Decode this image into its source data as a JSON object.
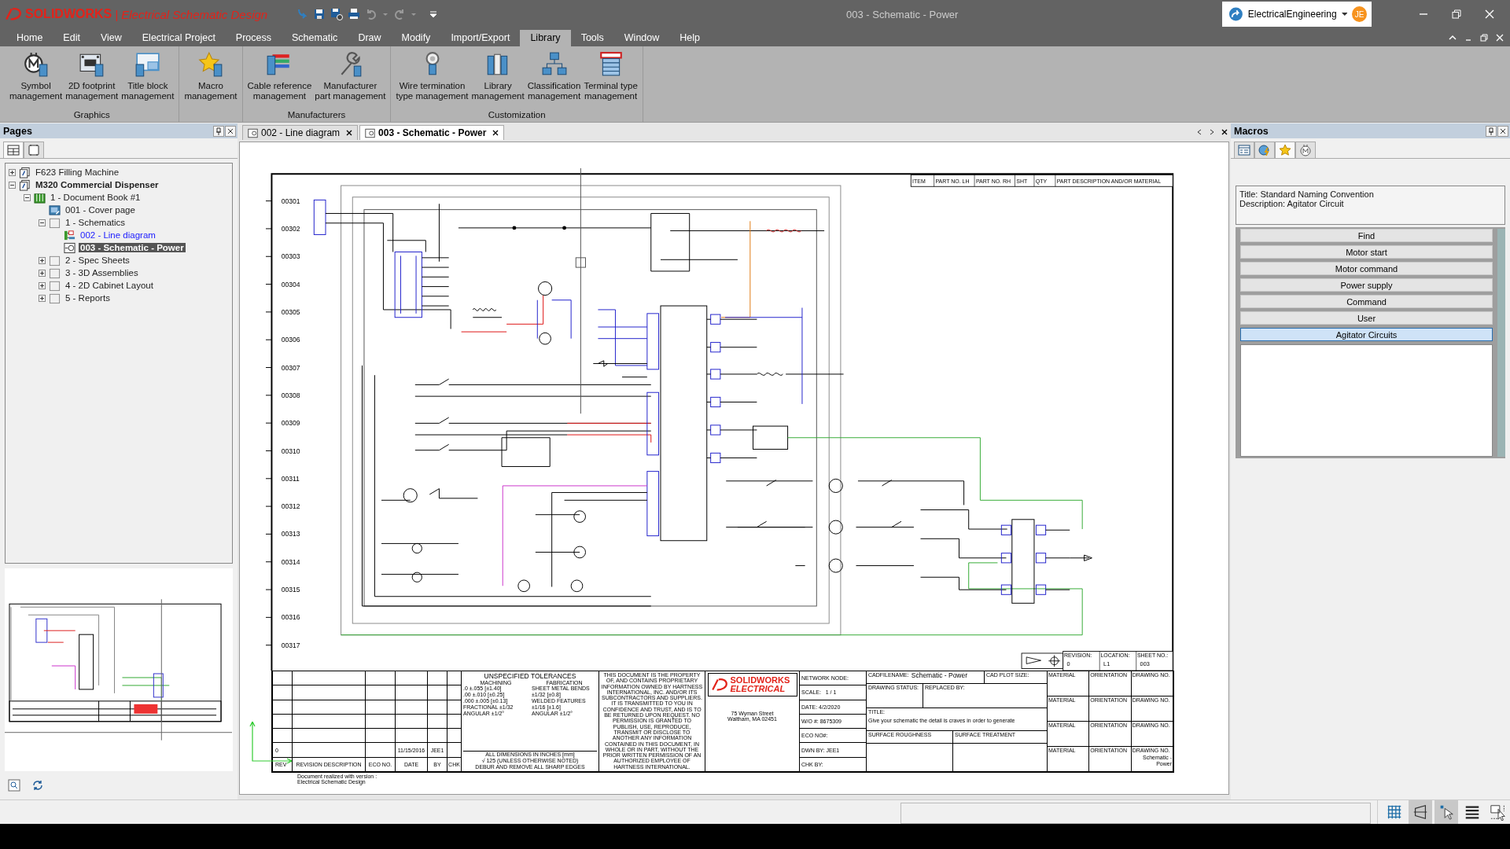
{
  "window": {
    "app_brand": "SOLIDWORKS",
    "app_name": "| Electrical Schematic Design",
    "title": "003 - Schematic - Power",
    "account": "ElectricalEngineering",
    "avatar_initials": "JE"
  },
  "menu_tabs": [
    {
      "label": "Home",
      "selected": false
    },
    {
      "label": "Edit",
      "selected": false
    },
    {
      "label": "View",
      "selected": false
    },
    {
      "label": "Electrical Project",
      "selected": false
    },
    {
      "label": "Process",
      "selected": false
    },
    {
      "label": "Schematic",
      "selected": false
    },
    {
      "label": "Draw",
      "selected": false
    },
    {
      "label": "Modify",
      "selected": false
    },
    {
      "label": "Import/Export",
      "selected": false
    },
    {
      "label": "Library",
      "selected": true
    },
    {
      "label": "Tools",
      "selected": false
    },
    {
      "label": "Window",
      "selected": false
    },
    {
      "label": "Help",
      "selected": false
    }
  ],
  "ribbon_groups": [
    {
      "label": "Graphics",
      "buttons": [
        "Symbol\nmanagement",
        "2D footprint\nmanagement",
        "Title block\nmanagement"
      ]
    },
    {
      "buttons": [
        "Macro\nmanagement"
      ]
    },
    {
      "label": "Manufacturers",
      "buttons": [
        "Cable reference\nmanagement",
        "Manufacturer\npart management"
      ]
    },
    {
      "label": "Customization",
      "buttons": [
        "Wire termination\ntype management",
        "Library\nmanagement",
        "Classification\nmanagement",
        "Terminal type\nmanagement"
      ]
    }
  ],
  "pages_panel": {
    "title": "Pages",
    "tabs": [
      {
        "selected": true
      },
      {
        "selected": false
      }
    ],
    "tree": [
      {
        "label": "F623 Filling Machine",
        "kind": "project",
        "active": false,
        "expanded": false,
        "selected": false
      },
      {
        "label": "M320 Commercial Dispenser",
        "kind": "project",
        "active": true,
        "expanded": true,
        "selected": false,
        "children": [
          {
            "label": "1 - Document Book #1",
            "kind": "book",
            "expanded": true,
            "selected": false,
            "children": [
              {
                "label": "001 - Cover page",
                "kind": "cover",
                "selected": false,
                "open": false
              },
              {
                "label": "1 - Schematics",
                "kind": "folder",
                "expanded": true,
                "selected": false,
                "children": [
                  {
                    "label": "002 - Line diagram",
                    "kind": "line-diagram",
                    "selected": false,
                    "open": true
                  },
                  {
                    "label": "003 - Schematic - Power",
                    "kind": "schematic",
                    "selected": true,
                    "open": true
                  }
                ]
              },
              {
                "label": "2 - Spec Sheets",
                "kind": "folder",
                "expanded": false,
                "selected": false
              },
              {
                "label": "3 - 3D Assemblies",
                "kind": "folder",
                "expanded": false,
                "selected": false
              },
              {
                "label": "4 - 2D Cabinet Layout",
                "kind": "folder",
                "expanded": false,
                "selected": false
              },
              {
                "label": "5 - Reports",
                "kind": "folder",
                "expanded": false,
                "selected": false
              }
            ]
          }
        ]
      }
    ]
  },
  "doc_tabs": [
    {
      "label": "002 - Line diagram",
      "selected": false
    },
    {
      "label": "003 - Schematic - Power",
      "selected": true
    }
  ],
  "schematic": {
    "row_numbers": [
      "00301",
      "00302",
      "00303",
      "00304",
      "00305",
      "00306",
      "00307",
      "00308",
      "00309",
      "00310",
      "00311",
      "00312",
      "00313",
      "00314",
      "00315",
      "00316",
      "00317"
    ],
    "parts_list_header": [
      "ITEM",
      "PART NO. LH",
      "PART NO. RH",
      "SHT",
      "QTY",
      "PART DESCRIPTION AND/OR MATERIAL"
    ],
    "sheet_info": {
      "labels": [
        "REVISION:",
        "LOCATION:",
        "SHEET NO.:"
      ],
      "values": [
        "0",
        "L1",
        "003"
      ]
    },
    "revision_headers": [
      "REV",
      "REVISION DESCRIPTION",
      "ECO NO.",
      "DATE",
      "BY",
      "CHK"
    ],
    "revision": {
      "rev": "0",
      "date": "11/15/2016",
      "by": "JEE1"
    },
    "tolerances": {
      "title": "UNSPECIFIED TOLERANCES",
      "machining_label": "MACHINING",
      "fabrication_label": "FABRICATION",
      "machining": [
        ".0   ±.055 [±1.40]",
        ".00   ±.010 [±0.25]",
        ".000  ±.005 [±0.13]",
        "FRACTIONAL ±1/32",
        "ANGULAR  ±1/2°"
      ],
      "fabrication": [
        "SHEET METAL BENDS  ±1/32 [±0.8]",
        "WELDED FEATURES  ±1/16 [±1.6]",
        "ANGULAR  ±1/2°"
      ],
      "notes": [
        "ALL DIMENSIONS IN INCHES [mm]",
        "√ 125 (UNLESS OTHERWISE NOTED)",
        "DEBUR AND REMOVE ALL SHARP EDGES"
      ]
    },
    "property_notice": "THIS DOCUMENT IS THE PROPERTY OF, AND CONTAINS PROPRIETARY INFORMATION OWNED BY HARTNESS INTERNATIONAL, INC. AND/OR ITS SUBCONTRACTORS AND SUPPLIERS. IT IS TRANSMITTED TO YOU IN CONFIDENCE AND TRUST, AND IS TO BE RETURNED UPON REQUEST. NO PERMISSION IS GRANTED TO PUBLISH, USE, REPRODUCE, TRANSMIT OR DISCLOSE TO ANOTHER ANY INFORMATION CONTAINED IN THIS DOCUMENT, IN WHOLE OR IN PART, WITHOUT THE PRIOR WRITTEN PERMISSION OF AN AUTHORIZED EMPLOYEE OF HARTNESS INTERNATIONAL.",
    "company": {
      "logo_top": "SOLIDWORKS",
      "logo_bottom": "ELECTRICAL",
      "address": [
        "75 Wyman Street",
        "Waltham, MA 02451"
      ]
    },
    "drawing_info": [
      "NETWORK NODE:",
      "SCALE:   1 / 1",
      "DATE: 4/2/2020",
      "W/O #: 8675309",
      "ECO NO#:",
      "DWN BY: JEE1",
      "CHK BY:"
    ],
    "cad": {
      "filename_label": "CADFILENAME:",
      "filename": "Schematic - Power",
      "plot_size_label": "CAD PLOT SIZE:",
      "status_label": "DRAWING STATUS:",
      "replaced_label": "REPLACED BY:",
      "title_label": "TITLE:",
      "title": "Give your schematic the detail is craves in order to generate",
      "roughness_label": "SURFACE ROUGHNESS",
      "treatment_label": "SURFACE TREATMENT"
    },
    "material_rows": [
      {
        "labels": [
          "MATERIAL",
          "ORIENTATION",
          "DRAWING NO."
        ]
      },
      {
        "labels": [
          "MATERIAL",
          "ORIENTATION",
          "DRAWING NO."
        ]
      },
      {
        "labels": [
          "MATERIAL",
          "ORIENTATION",
          "DRAWING NO."
        ]
      },
      {
        "labels": [
          "MATERIAL",
          "ORIENTATION",
          "DRAWING NO."
        ],
        "drawing_no": "Schematic - Power"
      }
    ],
    "version_note": "Document realized with version :",
    "software": "Electrical Schematic Design"
  },
  "macros_panel": {
    "title": "Macros",
    "tabs": [
      {
        "selected": false
      },
      {
        "selected": false
      },
      {
        "selected": true
      },
      {
        "selected": false
      }
    ],
    "info": [
      "Title: Standard Naming Convention",
      "Description: Agitator Circuit"
    ],
    "groups": [
      {
        "label": "Find",
        "selected": false
      },
      {
        "label": "Motor start",
        "selected": false
      },
      {
        "label": "Motor command",
        "selected": false
      },
      {
        "label": "Power supply",
        "selected": false
      },
      {
        "label": "Command",
        "selected": false
      },
      {
        "label": "User",
        "selected": false
      },
      {
        "label": "Agitator Circuits",
        "selected": true
      }
    ]
  },
  "status_bar": {
    "tools": [
      {
        "on": false
      },
      {
        "on": true
      },
      {
        "on": true
      },
      {
        "on": false
      },
      {
        "on": false
      }
    ]
  }
}
